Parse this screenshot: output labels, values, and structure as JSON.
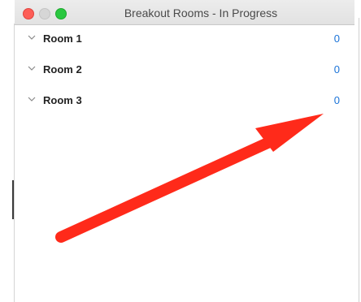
{
  "window": {
    "title": "Breakout Rooms - In Progress"
  },
  "rooms": [
    {
      "label": "Room 1",
      "count": "0"
    },
    {
      "label": "Room 2",
      "count": "0"
    },
    {
      "label": "Room 3",
      "count": "0"
    }
  ],
  "colors": {
    "close": "#fd5e57",
    "minimize": "#d6d6d6",
    "maximize": "#2ac840",
    "count_accent": "#1a73d8",
    "annotation_arrow": "#ff2a1a"
  },
  "icons": {
    "expand": "chevron-down-icon",
    "annotation": "red-arrow-annotation"
  }
}
